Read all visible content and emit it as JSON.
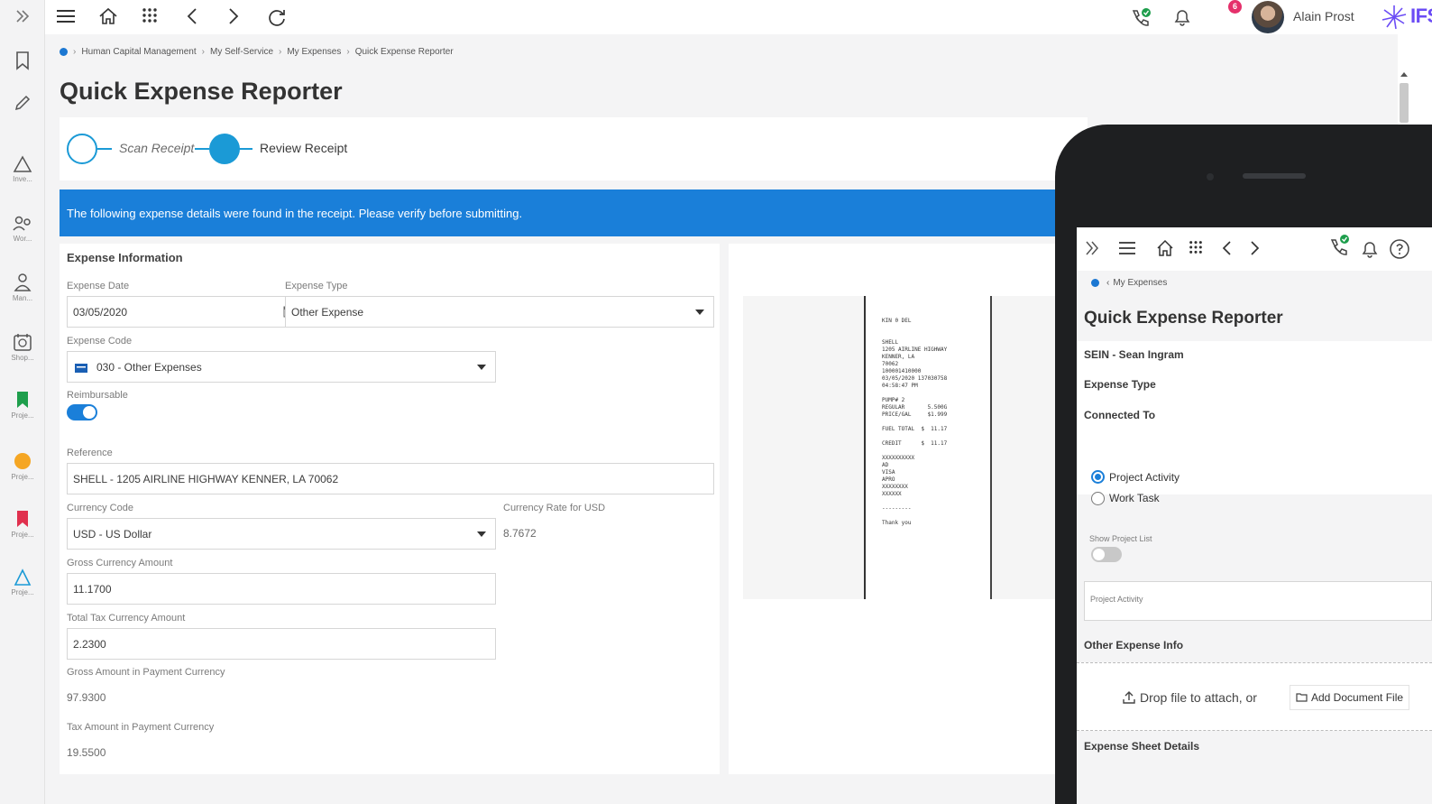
{
  "topbar": {
    "user_name": "Alain Prost",
    "notification_count": "6",
    "logo_text": "IFS"
  },
  "rail": {
    "items": [
      "Inve...",
      "Wor...",
      "Man...",
      "Shop...",
      "Proje...",
      "Proje...",
      "Proje...",
      "Proje..."
    ]
  },
  "breadcrumb": [
    "Human Capital Management",
    "My Self-Service",
    "My Expenses",
    "Quick Expense Reporter"
  ],
  "page_title": "Quick Expense Reporter",
  "wizard": {
    "step1": "Scan Receipt",
    "step2": "Review Receipt"
  },
  "banner": "The following expense details were found in the receipt. Please verify before submitting.",
  "expense": {
    "title": "Expense Information",
    "date_label": "Expense Date",
    "date_value": "03/05/2020",
    "type_label": "Expense Type",
    "type_value": "Other Expense",
    "code_label": "Expense Code",
    "code_value": "030 - Other Expenses",
    "reimbursable_label": "Reimbursable",
    "reimbursable": true,
    "reference_label": "Reference",
    "reference_value": "SHELL - 1205 AIRLINE HIGHWAY KENNER, LA 70062",
    "currency_label": "Currency Code",
    "currency_value": "USD - US Dollar",
    "rate_label": "Currency Rate for USD",
    "rate_value": "8.7672",
    "gross_label": "Gross Currency Amount",
    "gross_value": "11.1700",
    "tax_label": "Total Tax Currency Amount",
    "tax_value": "2.2300",
    "gross_pay_label": "Gross Amount in Payment Currency",
    "gross_pay_value": "97.9300",
    "tax_pay_label": "Tax Amount in Payment Currency",
    "tax_pay_value": "19.5500"
  },
  "receipt_text": "KIN 0 DEL\n\n\nSHELL\n1205 AIRLINE HIGHWAY\nKENNER, LA\n70062\n100001410000\n03/05/2020 137030758\n04:58:47 PM\n\nPUMP# 2\nREGULAR       5.500G\nPRICE/GAL     $1.999\n\nFUEL TOTAL  $  11.17\n\nCREDIT      $  11.17\n\nXXXXXXXXXX\nAD\nVISA\nAPRO\nXXXXXXXX\nXXXXXX\n\n---------\n\nThank you",
  "mobile": {
    "breadcrumb": "My Expenses",
    "title": "Quick Expense Reporter",
    "employee": "SEIN - Sean Ingram",
    "expense_type_label": "Expense Type",
    "connected_to_label": "Connected To",
    "radio_project_activity": "Project Activity",
    "radio_work_task": "Work Task",
    "show_project_list_label": "Show Project List",
    "project_activity_placeholder": "Project Activity",
    "other_expense_info_label": "Other Expense Info",
    "drop_text": "Drop file to attach, or",
    "add_document_button": "Add Document File",
    "sheet_details_label": "Expense Sheet Details"
  }
}
